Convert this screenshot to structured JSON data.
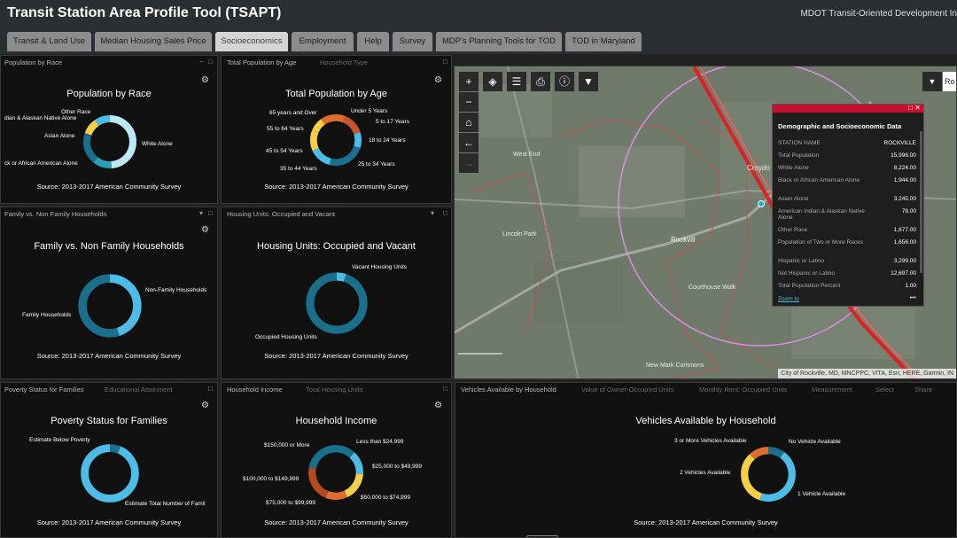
{
  "header": {
    "title": "Transit Station Area Profile Tool (TSAPT)",
    "right_text": "MDOT Transit-Oriented Development In"
  },
  "tabs": [
    "Transit & Land Use",
    "Median Housing Sales Price",
    "Socioeconomics",
    "Employment",
    "Help",
    "Survey",
    "MDP's Planning Tools for TOD",
    "TOD in Maryland"
  ],
  "active_tab": "Socioeconomics",
  "colors": {
    "dark_blue": "#1a6f8b",
    "light_blue": "#4dbde8",
    "pale_blue": "#bde8f4",
    "yellow": "#f4cf47",
    "orange": "#e06c2e",
    "teal": "#2a9fb5",
    "popup_bar": "#c8102e"
  },
  "source_text": "Source: 2013-2017 American Community Survey",
  "panels": {
    "race": {
      "tabs": [
        "Population by Race"
      ],
      "title": "Population by Race",
      "labels": [
        "Other Race",
        "dian & Alaskan Native Alone",
        "Asian Alone",
        "White Alone",
        "ck or African American Alone"
      ],
      "chart_data": {
        "type": "pie",
        "categories": [
          "White Alone",
          "Black or African American Alone",
          "Asian Alone",
          "American Indian & Alaskan Native Alone",
          "Other Race",
          "Population of Two or More Races"
        ],
        "values": [
          8224,
          1944,
          3245,
          78,
          1677,
          1656
        ]
      }
    },
    "age": {
      "tabs": [
        "Total Population by Age",
        "Household Type"
      ],
      "title": "Total Population by Age",
      "labels": [
        "65 years and Over",
        "Under 5 Years",
        "5 to 17 Years",
        "55 to 64 Years",
        "18 to 24 Years",
        "45 to 54 Years",
        "25 to 34 Years",
        "35 to 44 Years"
      ],
      "chart_data": {
        "type": "pie",
        "categories": [
          "Under 5 Years",
          "5 to 17 Years",
          "18 to 24 Years",
          "25 to 34 Years",
          "35 to 44 Years",
          "45 to 54 Years",
          "55 to 64 Years",
          "65 years and Over"
        ],
        "values": [
          6,
          14,
          10,
          24,
          14,
          13,
          9,
          10
        ]
      }
    },
    "family": {
      "tabs": [
        "Family vs. Non Family Households"
      ],
      "title": "Family vs. Non Family Households",
      "labels": [
        "Non-Family Households",
        "Family Households"
      ],
      "chart_data": {
        "type": "pie",
        "categories": [
          "Non-Family Households",
          "Family Households"
        ],
        "values": [
          45,
          55
        ]
      }
    },
    "housing": {
      "tabs": [
        "Housing Units: Occupied and Vacant"
      ],
      "title": "Housing Units: Occupied and Vacant",
      "labels": [
        "Vacant Housing Units",
        "Occupied Housing Units"
      ],
      "chart_data": {
        "type": "pie",
        "categories": [
          "Vacant Housing Units",
          "Occupied Housing Units"
        ],
        "values": [
          5,
          95
        ]
      }
    },
    "poverty": {
      "tabs": [
        "Poverty Status for Families",
        "Educational Attainment"
      ],
      "title": "Poverty Status for Families",
      "labels": [
        "Estimate Below Poverty",
        "Estimate Total Number of Famil"
      ],
      "chart_data": {
        "type": "pie",
        "categories": [
          "Estimate Below Poverty",
          "Estimate Total Number of Families"
        ],
        "values": [
          6,
          94
        ]
      }
    },
    "income": {
      "tabs": [
        "Household Income",
        "Total Housing Units"
      ],
      "title": "Household Income",
      "labels": [
        "$150,000 or More",
        "Less than $24,999",
        "$25,000 to $49,999",
        "$100,000 to $149,999",
        "$75,000 to $99,999",
        "$50,000 to $74,999"
      ],
      "chart_data": {
        "type": "pie",
        "categories": [
          "Less than $24,999",
          "$25,000 to $49,999",
          "$50,000 to $74,999",
          "$75,000 to $99,999",
          "$100,000 to $149,999",
          "$150,000 or More"
        ],
        "values": [
          12,
          14,
          17,
          13,
          22,
          22
        ]
      }
    },
    "vehicles": {
      "tabs": [
        "Vehicles Available by Household",
        "Value of Owner-Occupied Units",
        "Monthly Rent: Occupied Units",
        "Measurement",
        "Select",
        "Share"
      ],
      "title": "Vehicles Available by Household",
      "labels": [
        "3 or More Vehicles Available",
        "No Vehicle Available",
        "2 Vehicles Available",
        "1 Vehicle Available"
      ],
      "chart_data": {
        "type": "pie",
        "categories": [
          "No Vehicle Available",
          "1 Vehicle Available",
          "2 Vehicles Available",
          "3 or More Vehicles Available"
        ],
        "values": [
          10,
          45,
          33,
          12
        ]
      }
    }
  },
  "map": {
    "search_text": "Ro",
    "place_labels": [
      "Rockvill",
      "West End",
      "Croydo",
      "Lincoln Park",
      "Courthouse Walk",
      "New Mark Commons"
    ],
    "attribution": "City of Rockville, MD, MNCPPC, VITA, Esri, HERE, Garmin, IN",
    "popup": {
      "title": "Demographic and Socioeconomic Data",
      "zoom_link": "Zoom to",
      "more": "•••",
      "rows": [
        {
          "k": "STATION NAME",
          "v": "ROCKVILLE"
        },
        {
          "k": "Total Population",
          "v": "15,996.00"
        },
        {
          "k": "White Alone",
          "v": "8,224.00"
        },
        {
          "k": "Black or African American Alone",
          "v": "1,944.00"
        },
        {
          "k": "Asian Alone",
          "v": "3,245.00"
        },
        {
          "k": "American Indian & Alaskan Native Alone",
          "v": "78.00"
        },
        {
          "k": "Other Race",
          "v": "1,677.00"
        },
        {
          "k": "Population of Two or More Races",
          "v": "1,656.00"
        },
        {
          "k": "Hispanic or Latino",
          "v": "3,299.00"
        },
        {
          "k": "Not Hispanic or Latino",
          "v": "12,697.00"
        },
        {
          "k": "Total Population Percent",
          "v": "1.00"
        }
      ]
    }
  }
}
